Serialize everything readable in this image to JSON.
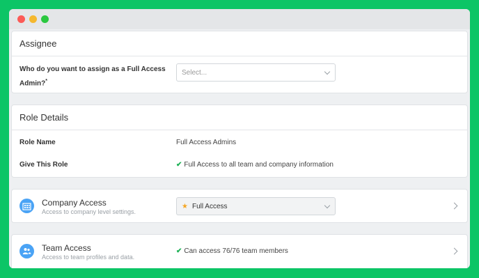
{
  "assignee": {
    "header": "Assignee",
    "question": "Who do you want to assign as a Full Access Admin?",
    "required_mark": "*",
    "select_placeholder": "Select..."
  },
  "role_details": {
    "header": "Role Details",
    "rows": [
      {
        "label": "Role Name",
        "value": "Full Access Admins"
      },
      {
        "label": "Give This Role",
        "value": "Full Access to all team and company information"
      }
    ]
  },
  "company_access": {
    "title": "Company Access",
    "subtitle": "Access to company level settings.",
    "selected": "Full Access",
    "icon": "building-icon"
  },
  "team_access": {
    "title": "Team Access",
    "subtitle": "Access to team profiles and data.",
    "value": "Can access 76/76 team members",
    "icon": "people-icon"
  },
  "colors": {
    "background": "#0cc566",
    "accent_blue": "#4aa3f5",
    "check_green": "#1fb257",
    "star": "#f5a623"
  }
}
